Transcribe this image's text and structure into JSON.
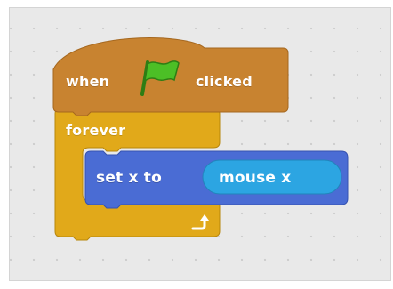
{
  "script": {
    "hat_block": {
      "label_before": "when",
      "flag_icon": "green-flag-icon",
      "label_after": "clicked",
      "color": "#c88330"
    },
    "forever_block": {
      "label": "forever",
      "loop_icon": "loop-arrow-icon",
      "color": "#e1a91a"
    },
    "motion_block": {
      "label": "set x to",
      "reporter": "mouse x",
      "color": "#4a6cd4",
      "reporter_color": "#2ca5e2"
    }
  }
}
